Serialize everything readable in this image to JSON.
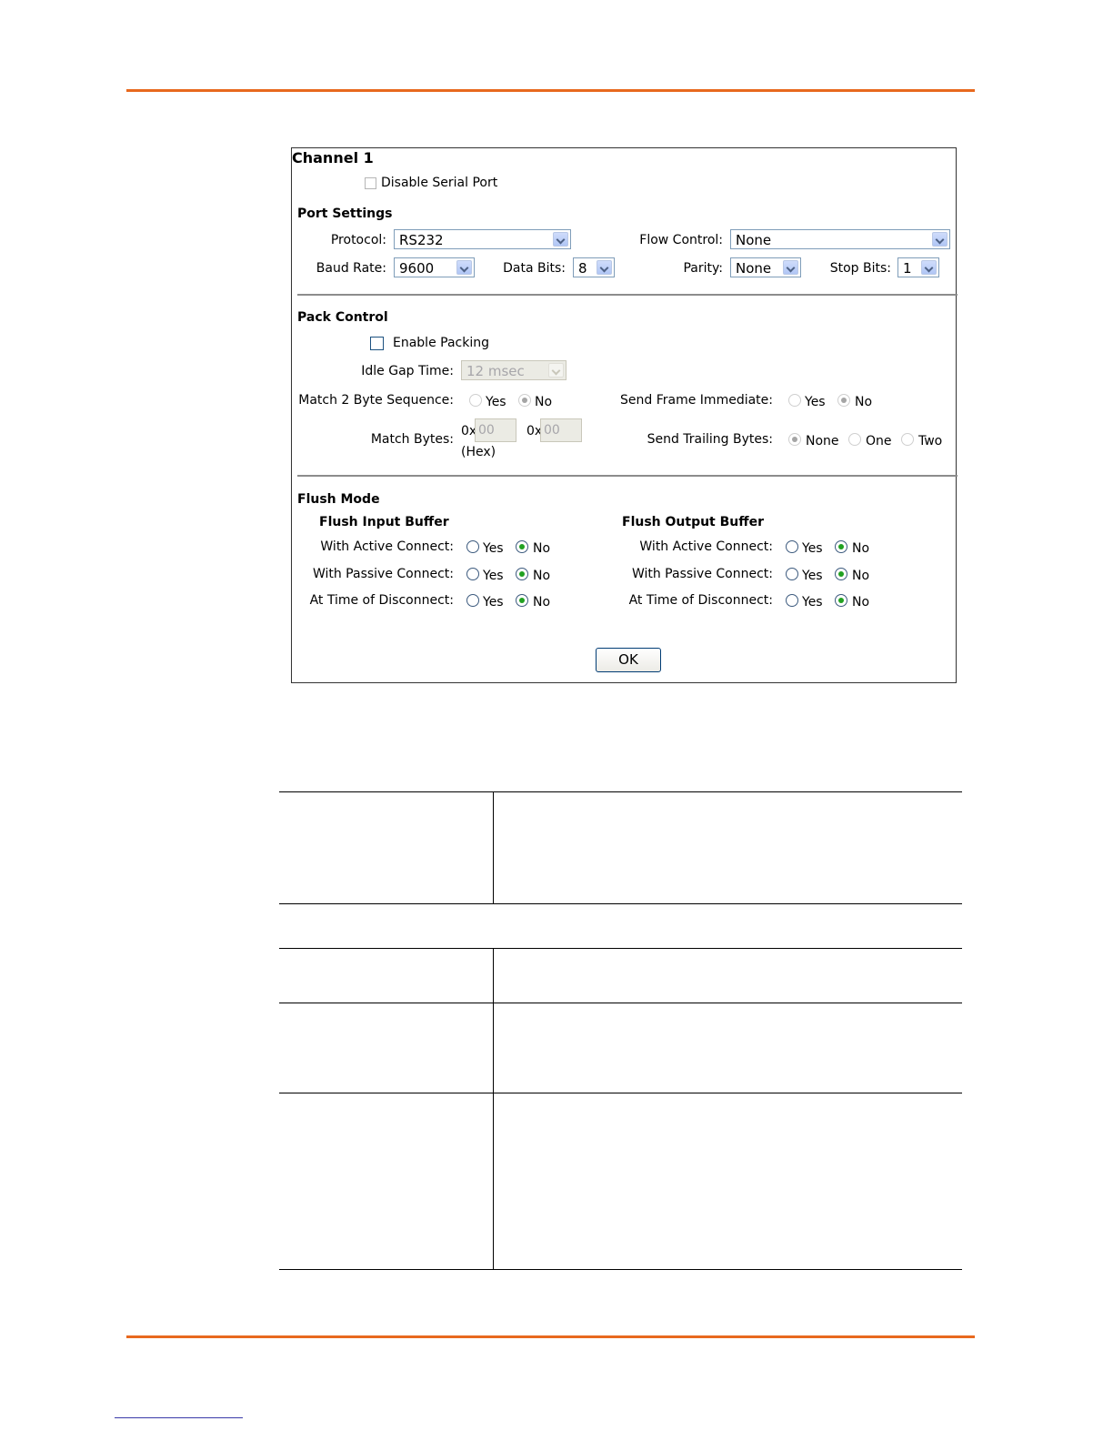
{
  "dialog": {
    "title": "Channel 1",
    "disable_serial_port": {
      "label": "Disable Serial Port",
      "checked": false
    },
    "port_settings": {
      "heading": "Port Settings",
      "protocol": {
        "label": "Protocol:",
        "value": "RS232"
      },
      "flow_control": {
        "label": "Flow Control:",
        "value": "None"
      },
      "baud_rate": {
        "label": "Baud Rate:",
        "value": "9600"
      },
      "data_bits": {
        "label": "Data Bits:",
        "value": "8"
      },
      "parity": {
        "label": "Parity:",
        "value": "None"
      },
      "stop_bits": {
        "label": "Stop Bits:",
        "value": "1"
      }
    },
    "pack_control": {
      "heading": "Pack Control",
      "enable_packing": {
        "label": "Enable Packing",
        "checked": false
      },
      "idle_gap_time": {
        "label": "Idle Gap Time:",
        "value": "12 msec"
      },
      "match_2_byte_sequence": {
        "label": "Match 2 Byte Sequence:",
        "yes": "Yes",
        "no": "No",
        "selected": "No"
      },
      "send_frame_immediate": {
        "label": "Send Frame Immediate:",
        "yes": "Yes",
        "no": "No",
        "selected": "No"
      },
      "match_bytes": {
        "label": "Match Bytes:",
        "prefix1": "0x",
        "value1": "00",
        "prefix2": "0x",
        "value2": "00",
        "hex_note": "(Hex)"
      },
      "send_trailing_bytes": {
        "label": "Send Trailing Bytes:",
        "none": "None",
        "one": "One",
        "two": "Two",
        "selected": "None"
      }
    },
    "flush_mode": {
      "heading": "Flush Mode",
      "input_buffer": {
        "heading": "Flush Input Buffer",
        "active_connect": {
          "label": "With Active Connect:",
          "yes": "Yes",
          "no": "No",
          "selected": "No"
        },
        "passive_connect": {
          "label": "With Passive Connect:",
          "yes": "Yes",
          "no": "No",
          "selected": "No"
        },
        "disconnect": {
          "label": "At Time of Disconnect:",
          "yes": "Yes",
          "no": "No",
          "selected": "No"
        }
      },
      "output_buffer": {
        "heading": "Flush Output Buffer",
        "active_connect": {
          "label": "With Active Connect:",
          "yes": "Yes",
          "no": "No",
          "selected": "No"
        },
        "passive_connect": {
          "label": "With Passive Connect:",
          "yes": "Yes",
          "no": "No",
          "selected": "No"
        },
        "disconnect": {
          "label": "At Time of Disconnect:",
          "yes": "Yes",
          "no": "No",
          "selected": "No"
        }
      }
    },
    "ok_label": "OK"
  },
  "colors": {
    "rule_orange": "#e8691e",
    "radio_checked_green": "#21a121",
    "select_border": "#7f9db9"
  }
}
